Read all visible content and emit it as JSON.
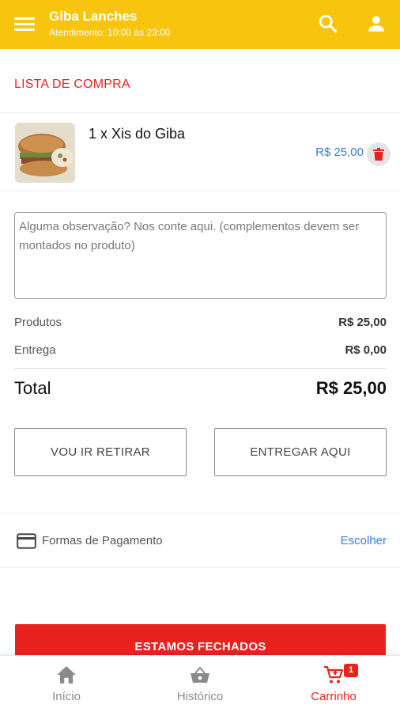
{
  "appbar": {
    "title": "Giba Lanches",
    "subtitle": "Atendimento: 10:00 às 23:00"
  },
  "cart": {
    "section_title": "LISTA DE COMPRA",
    "items": [
      {
        "name": "1 x Xis do Giba",
        "price": "R$ 25,00"
      }
    ]
  },
  "observation": {
    "placeholder": "Alguma observação? Nos conte aqui. (complementos devem ser montados no produto)"
  },
  "summary": {
    "products_label": "Produtos",
    "products_value": "R$ 25,00",
    "delivery_label": "Entrega",
    "delivery_value": "R$ 0,00",
    "total_label": "Total",
    "total_value": "R$ 25,00"
  },
  "delivery_options": {
    "pickup_label": "VOU IR RETIRAR",
    "deliver_label": "ENTREGAR AQUI"
  },
  "payment": {
    "label": "Formas de Pagamento",
    "action": "Escolher"
  },
  "checkout": {
    "status_label": "ESTAMOS FECHADOS"
  },
  "bottom_nav": {
    "items": [
      {
        "label": "Início",
        "icon": "home-icon"
      },
      {
        "label": "Histórico",
        "icon": "basket-icon"
      },
      {
        "label": "Carrinho",
        "icon": "cart-icon",
        "badge": "1"
      }
    ]
  },
  "colors": {
    "appbar": "#f7c40e",
    "accent_red": "#e8231f",
    "link_blue": "#3b7dd8"
  }
}
